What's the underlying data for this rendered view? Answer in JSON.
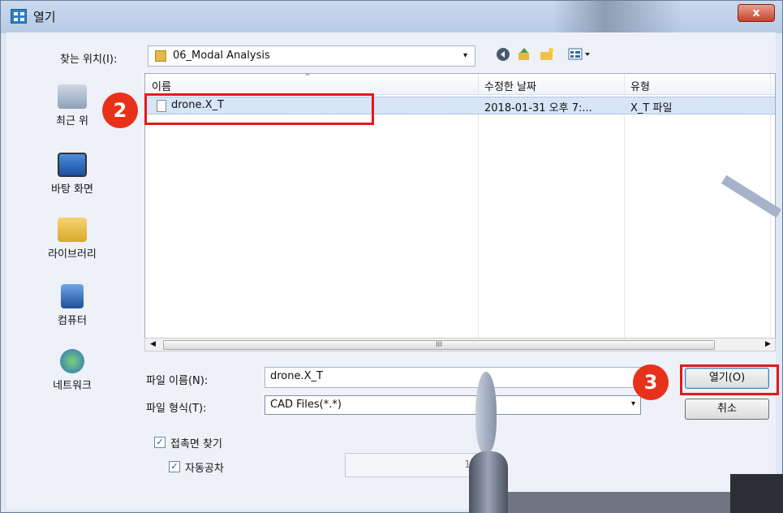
{
  "window": {
    "title": "열기",
    "close_label": "x"
  },
  "toolbar": {
    "look_in_label": "찾는 위치(I):",
    "look_in_value": "06_Modal Analysis",
    "dropdown_glyph": "▾",
    "icons": [
      "back-icon",
      "up-folder-icon",
      "new-folder-icon",
      "view-menu-icon"
    ]
  },
  "places": [
    {
      "label": "최근 위",
      "icon": "recent-places-icon"
    },
    {
      "label": "바탕 화면",
      "icon": "desktop-icon"
    },
    {
      "label": "라이브러리",
      "icon": "libraries-icon"
    },
    {
      "label": "컴퓨터",
      "icon": "computer-icon"
    },
    {
      "label": "네트워크",
      "icon": "network-icon"
    }
  ],
  "list": {
    "columns": [
      "이름",
      "수정한 날짜",
      "유형"
    ],
    "rows": [
      {
        "name": "drone.X_T",
        "modified": "2018-01-31 오후 7:...",
        "type": "X_T 파일"
      }
    ],
    "scroll_grip": "III"
  },
  "file_name": {
    "label": "파일 이름(N):",
    "value": "drone.X_T"
  },
  "file_type": {
    "label": "파일 형식(T):",
    "value": "CAD Files(*.*)"
  },
  "buttons": {
    "open": "열기(O)",
    "cancel": "취소"
  },
  "options": {
    "find_contact": "접촉면 찾기",
    "auto_tolerance": "자동공차",
    "tolerance_value": "1",
    "checked_glyph": "✓"
  },
  "badges": {
    "step2": "2",
    "step3": "3"
  },
  "colors": {
    "badge": "#e8311a",
    "highlight": "#e8161a",
    "selection": "#d7e5f7"
  }
}
